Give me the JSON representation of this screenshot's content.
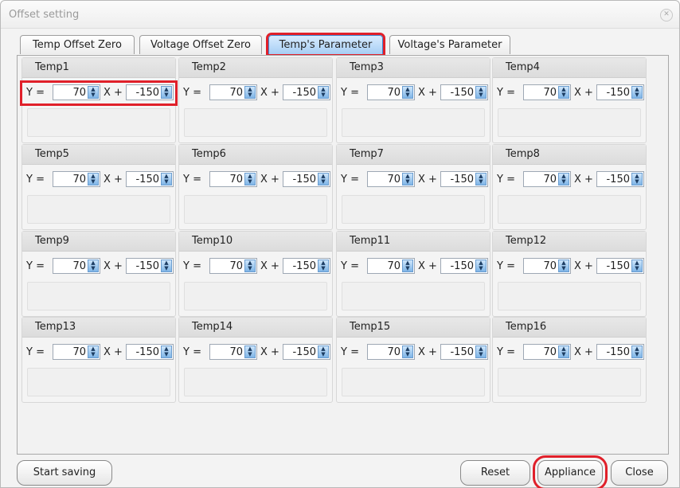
{
  "window": {
    "title": "Offset setting"
  },
  "tabs": [
    {
      "label": "Temp Offset Zero",
      "active": false
    },
    {
      "label": "Voltage Offset Zero",
      "active": false
    },
    {
      "label": "Temp's Parameter",
      "active": true
    },
    {
      "label": "Voltage's Parameter",
      "active": false
    }
  ],
  "panels": [
    {
      "title": "Temp1",
      "y_label": "Y =",
      "y_value": "70",
      "x_label": "X +",
      "x_value": "-150",
      "highlighted": true
    },
    {
      "title": "Temp2",
      "y_label": "Y =",
      "y_value": "70",
      "x_label": "X +",
      "x_value": "-150"
    },
    {
      "title": "Temp3",
      "y_label": "Y =",
      "y_value": "70",
      "x_label": "X +",
      "x_value": "-150"
    },
    {
      "title": "Temp4",
      "y_label": "Y =",
      "y_value": "70",
      "x_label": "X +",
      "x_value": "-150"
    },
    {
      "title": "Temp5",
      "y_label": "Y =",
      "y_value": "70",
      "x_label": "X +",
      "x_value": "-150"
    },
    {
      "title": "Temp6",
      "y_label": "Y =",
      "y_value": "70",
      "x_label": "X +",
      "x_value": "-150"
    },
    {
      "title": "Temp7",
      "y_label": "Y =",
      "y_value": "70",
      "x_label": "X +",
      "x_value": "-150"
    },
    {
      "title": "Temp8",
      "y_label": "Y =",
      "y_value": "70",
      "x_label": "X +",
      "x_value": "-150"
    },
    {
      "title": "Temp9",
      "y_label": "Y =",
      "y_value": "70",
      "x_label": "X +",
      "x_value": "-150"
    },
    {
      "title": "Temp10",
      "y_label": "Y =",
      "y_value": "70",
      "x_label": "X +",
      "x_value": "-150"
    },
    {
      "title": "Temp11",
      "y_label": "Y =",
      "y_value": "70",
      "x_label": "X +",
      "x_value": "-150"
    },
    {
      "title": "Temp12",
      "y_label": "Y =",
      "y_value": "70",
      "x_label": "X +",
      "x_value": "-150"
    },
    {
      "title": "Temp13",
      "y_label": "Y =",
      "y_value": "70",
      "x_label": "X +",
      "x_value": "-150"
    },
    {
      "title": "Temp14",
      "y_label": "Y =",
      "y_value": "70",
      "x_label": "X +",
      "x_value": "-150"
    },
    {
      "title": "Temp15",
      "y_label": "Y =",
      "y_value": "70",
      "x_label": "X +",
      "x_value": "-150"
    },
    {
      "title": "Temp16",
      "y_label": "Y =",
      "y_value": "70",
      "x_label": "X +",
      "x_value": "-150"
    }
  ],
  "buttons": {
    "start_saving": "Start saving",
    "reset": "Reset",
    "appliance": "Appliance",
    "close": "Close"
  },
  "colors": {
    "highlight": "#e0202a",
    "active_tab": "#a6cef4",
    "spinner": "#7fb5e7"
  },
  "icons": {
    "spin": "up-down-arrows-icon",
    "window_button": "close-icon"
  }
}
